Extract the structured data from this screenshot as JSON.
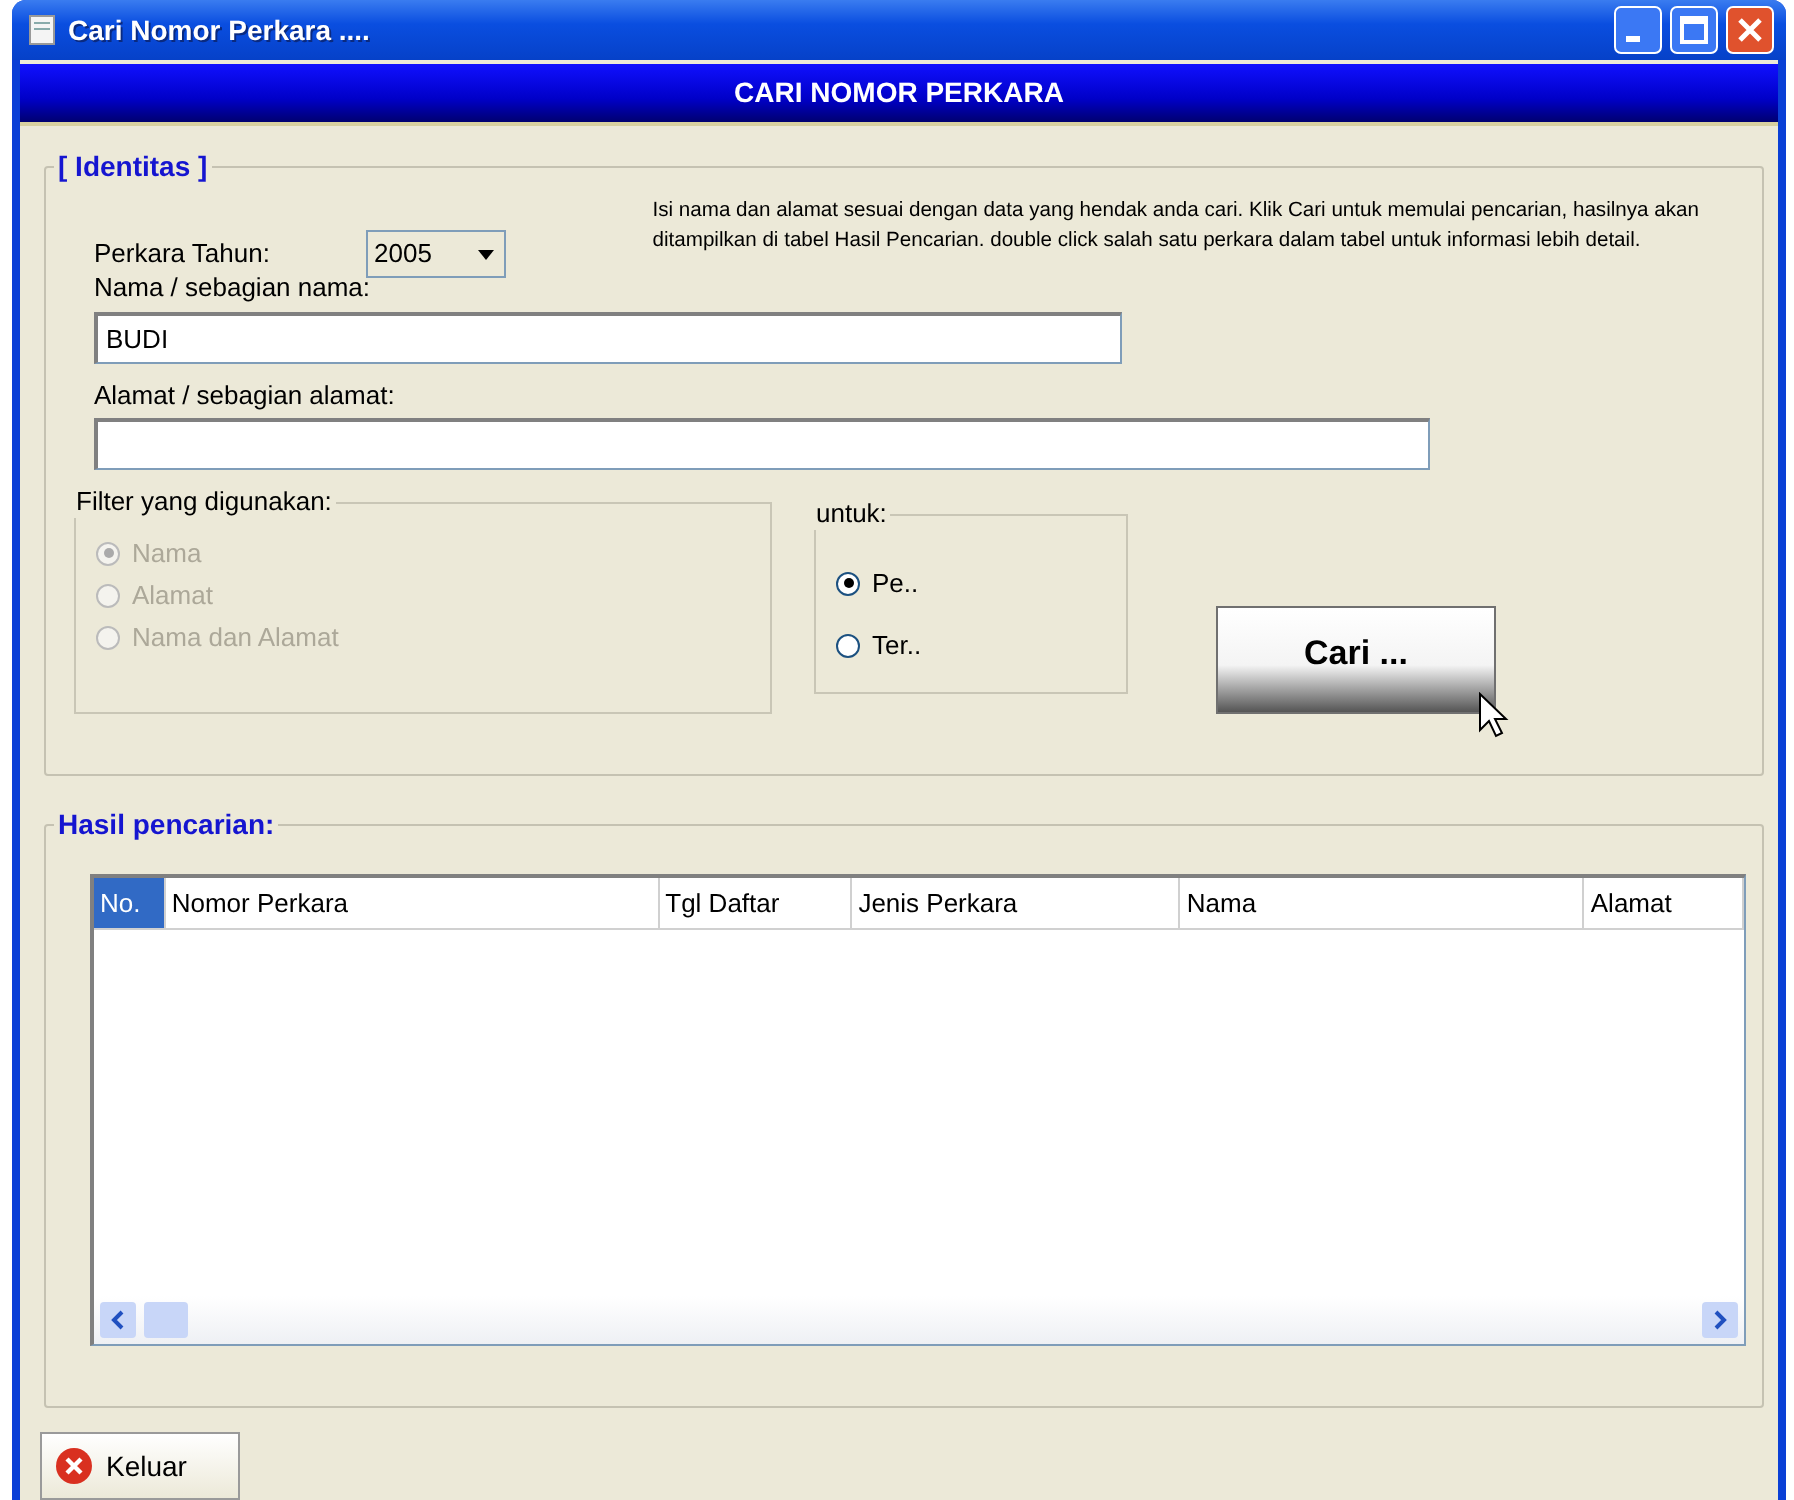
{
  "window": {
    "title": "Cari Nomor Perkara ...."
  },
  "banner": "CARI NOMOR PERKARA",
  "identitas": {
    "legend": "[ Identitas ]",
    "year_label": "Perkara Tahun:",
    "year_value": "2005",
    "help_text": "Isi nama dan alamat sesuai dengan data yang hendak anda cari. Klik Cari untuk memulai pencarian, hasilnya akan ditampilkan di tabel Hasil Pencarian. double click salah satu perkara dalam tabel untuk informasi lebih detail.",
    "name_label": "Nama / sebagian nama:",
    "name_value": "BUDI",
    "address_label": "Alamat / sebagian alamat:"
  },
  "filter": {
    "legend": "Filter yang digunakan:",
    "disabled": true,
    "options": [
      {
        "label": "Nama",
        "selected": true
      },
      {
        "label": "Alamat",
        "selected": false
      },
      {
        "label": "Nama dan Alamat",
        "selected": false
      }
    ]
  },
  "untuk": {
    "legend": "untuk:",
    "options": [
      {
        "label": "Pe..",
        "selected": true
      },
      {
        "label": "Ter..",
        "selected": false
      }
    ]
  },
  "search_button": "Cari ...",
  "results": {
    "legend": "Hasil pencarian:",
    "columns": [
      {
        "label": "No.",
        "selected": true
      },
      {
        "label": "Nomor Perkara",
        "selected": false
      },
      {
        "label": "Tgl Daftar",
        "selected": false
      },
      {
        "label": "Jenis Perkara",
        "selected": false
      },
      {
        "label": "Nama",
        "selected": false
      },
      {
        "label": "Alamat",
        "selected": false
      }
    ]
  },
  "exit_button": "Keluar"
}
